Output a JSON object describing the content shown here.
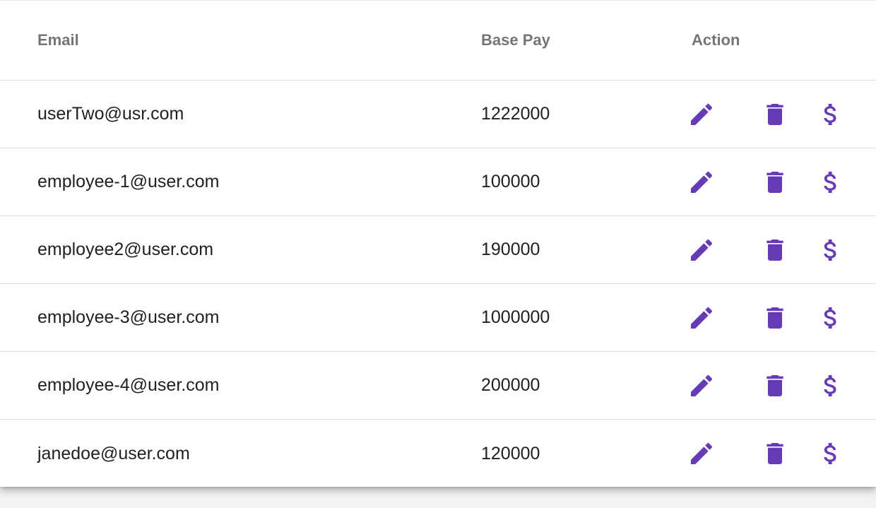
{
  "table": {
    "headers": {
      "email": "Email",
      "base_pay": "Base Pay",
      "action": "Action"
    },
    "rows": [
      {
        "email": "userTwo@usr.com",
        "base_pay": "1222000"
      },
      {
        "email": "employee-1@user.com",
        "base_pay": "100000"
      },
      {
        "email": "employee2@user.com",
        "base_pay": "190000"
      },
      {
        "email": "employee-3@user.com",
        "base_pay": "1000000"
      },
      {
        "email": "employee-4@user.com",
        "base_pay": "200000"
      },
      {
        "email": "janedoe@user.com",
        "base_pay": "120000"
      }
    ],
    "row_actions": [
      "edit-icon",
      "delete-icon",
      "dollar-icon"
    ]
  },
  "colors": {
    "icon_accent": "#673ab7",
    "header_text": "#757575",
    "body_text": "#212121",
    "divider": "#dcdcdc"
  }
}
